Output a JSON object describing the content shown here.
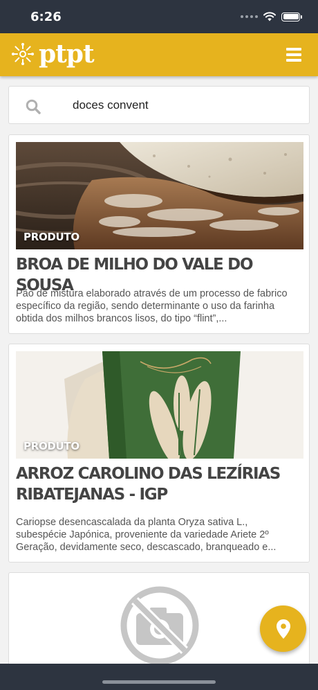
{
  "status_bar": {
    "time": "6:26"
  },
  "header": {
    "logo_text": "ptpt"
  },
  "search": {
    "value": "doces convent",
    "placeholder": ""
  },
  "results": [
    {
      "badge": "PRODUTO",
      "title": "BROA DE MILHO DO VALE DO SOUSA",
      "description": "Pão de mistura elaborado através de um processo de fabrico específico da região, sendo determinante o uso da farinha obtida dos milhos brancos lisos, do tipo “flint”,..."
    },
    {
      "badge": "PRODUTO",
      "title": "ARROZ CAROLINO DAS LEZÍRIAS RIBATEJANAS - IGP",
      "description": "Cariopse desencascalada da planta Oryza sativa L., subespécie Japónica, proveniente da variedade Ariete 2º Geração, devidamente seco, descascado, branqueado e..."
    }
  ],
  "colors": {
    "accent": "#e6b31e",
    "status_bar": "#2d3440"
  },
  "icons": {
    "search": "search-icon",
    "menu": "menu-icon",
    "location": "location-pin-icon",
    "no_image": "no-photo-icon"
  }
}
